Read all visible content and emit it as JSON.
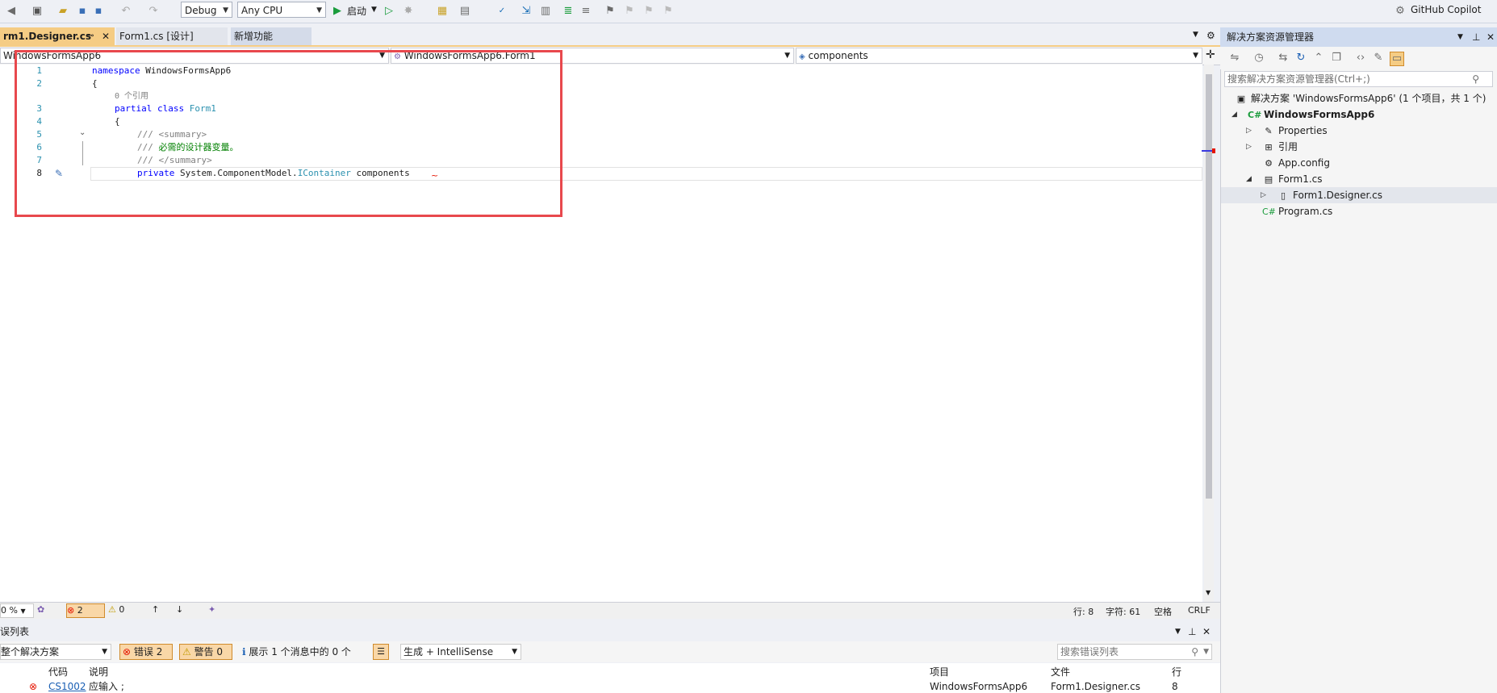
{
  "toolbar": {
    "config": "Debug",
    "platform": "Any CPU",
    "start_label": "启动",
    "copilot": "GitHub Copilot"
  },
  "tabs": [
    {
      "label": "rm1.Designer.cs",
      "active": true
    },
    {
      "label": "Form1.cs [设计]",
      "active": false
    },
    {
      "label": "新增功能",
      "active": false
    }
  ],
  "navbar": {
    "project": "WindowsFormsApp6",
    "type": "WindowsFormsApp6.Form1",
    "member": "components"
  },
  "code": {
    "lines": [
      "1",
      "2",
      "3",
      "4",
      "5",
      "6",
      "7",
      "8"
    ],
    "ref_count": "0 个引用",
    "line1_kw": "namespace",
    "line1_name": "WindowsFormsApp6",
    "brace_open": "{",
    "line3_kw1": "partial",
    "line3_kw2": "class",
    "line3_type": "Form1",
    "line5": "/// <summary>",
    "line6_prefix": "///",
    "line6_text": "必需的设计器变量。",
    "line7": "/// </summary>",
    "line8_kw": "private",
    "line8_ns": "System.ComponentModel.",
    "line8_type": "IContainer",
    "line8_name": "components"
  },
  "status": {
    "zoom": "0 %",
    "errors": "2",
    "warnings": "0",
    "line": "行: 8",
    "char": "字符: 61",
    "spaces": "空格",
    "eol": "CRLF"
  },
  "error_list": {
    "title": "误列表",
    "scope": "整个解决方案",
    "errors_btn": "错误 2",
    "warnings_btn": "警告 0",
    "messages_btn": "展示 1 个消息中的 0 个",
    "build_filter": "生成 + IntelliSense",
    "search_placeholder": "搜索错误列表",
    "columns": {
      "code": "代码",
      "desc": "说明",
      "project": "项目",
      "file": "文件",
      "line": "行"
    },
    "rows": [
      {
        "code": "CS1002",
        "desc": "应输入 ;",
        "project": "WindowsFormsApp6",
        "file": "Form1.Designer.cs",
        "line": "8"
      }
    ]
  },
  "solution_explorer": {
    "title": "解决方案资源管理器",
    "search_placeholder": "搜索解决方案资源管理器(Ctrl+;)",
    "items": [
      {
        "label": "解决方案 'WindowsFormsApp6' (1 个项目，共 1 个)",
        "icon": "solution-icon"
      },
      {
        "label": "WindowsFormsApp6",
        "icon": "csharp-project-icon"
      },
      {
        "label": "Properties",
        "icon": "wrench-icon"
      },
      {
        "label": "引用",
        "icon": "references-icon"
      },
      {
        "label": "App.config",
        "icon": "config-icon"
      },
      {
        "label": "Form1.cs",
        "icon": "form-icon"
      },
      {
        "label": "Form1.Designer.cs",
        "icon": "file-icon"
      },
      {
        "label": "Program.cs",
        "icon": "csharp-file-icon"
      }
    ]
  }
}
